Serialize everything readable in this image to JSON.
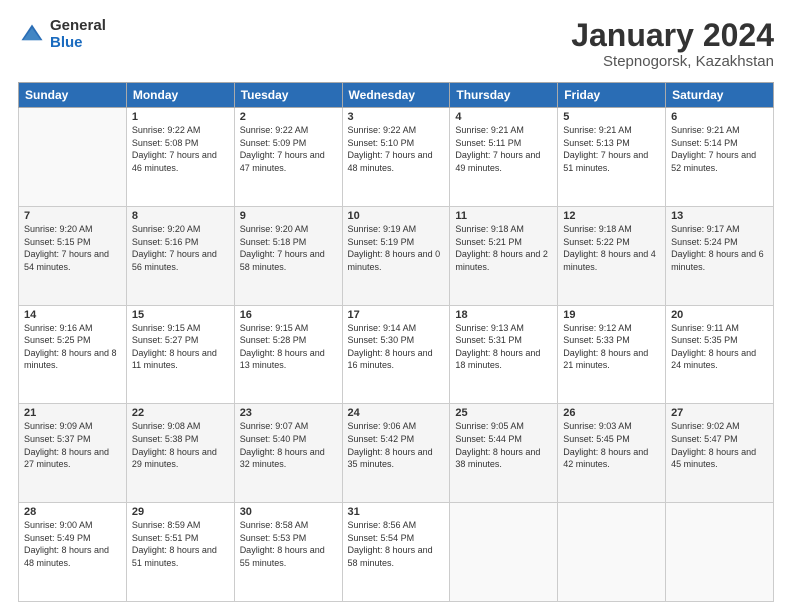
{
  "header": {
    "logo_general": "General",
    "logo_blue": "Blue",
    "title": "January 2024",
    "location": "Stepnogorsk, Kazakhstan"
  },
  "weekdays": [
    "Sunday",
    "Monday",
    "Tuesday",
    "Wednesday",
    "Thursday",
    "Friday",
    "Saturday"
  ],
  "weeks": [
    [
      {
        "day": "",
        "sunrise": "",
        "sunset": "",
        "daylight": ""
      },
      {
        "day": "1",
        "sunrise": "Sunrise: 9:22 AM",
        "sunset": "Sunset: 5:08 PM",
        "daylight": "Daylight: 7 hours and 46 minutes."
      },
      {
        "day": "2",
        "sunrise": "Sunrise: 9:22 AM",
        "sunset": "Sunset: 5:09 PM",
        "daylight": "Daylight: 7 hours and 47 minutes."
      },
      {
        "day": "3",
        "sunrise": "Sunrise: 9:22 AM",
        "sunset": "Sunset: 5:10 PM",
        "daylight": "Daylight: 7 hours and 48 minutes."
      },
      {
        "day": "4",
        "sunrise": "Sunrise: 9:21 AM",
        "sunset": "Sunset: 5:11 PM",
        "daylight": "Daylight: 7 hours and 49 minutes."
      },
      {
        "day": "5",
        "sunrise": "Sunrise: 9:21 AM",
        "sunset": "Sunset: 5:13 PM",
        "daylight": "Daylight: 7 hours and 51 minutes."
      },
      {
        "day": "6",
        "sunrise": "Sunrise: 9:21 AM",
        "sunset": "Sunset: 5:14 PM",
        "daylight": "Daylight: 7 hours and 52 minutes."
      }
    ],
    [
      {
        "day": "7",
        "sunrise": "Sunrise: 9:20 AM",
        "sunset": "Sunset: 5:15 PM",
        "daylight": "Daylight: 7 hours and 54 minutes."
      },
      {
        "day": "8",
        "sunrise": "Sunrise: 9:20 AM",
        "sunset": "Sunset: 5:16 PM",
        "daylight": "Daylight: 7 hours and 56 minutes."
      },
      {
        "day": "9",
        "sunrise": "Sunrise: 9:20 AM",
        "sunset": "Sunset: 5:18 PM",
        "daylight": "Daylight: 7 hours and 58 minutes."
      },
      {
        "day": "10",
        "sunrise": "Sunrise: 9:19 AM",
        "sunset": "Sunset: 5:19 PM",
        "daylight": "Daylight: 8 hours and 0 minutes."
      },
      {
        "day": "11",
        "sunrise": "Sunrise: 9:18 AM",
        "sunset": "Sunset: 5:21 PM",
        "daylight": "Daylight: 8 hours and 2 minutes."
      },
      {
        "day": "12",
        "sunrise": "Sunrise: 9:18 AM",
        "sunset": "Sunset: 5:22 PM",
        "daylight": "Daylight: 8 hours and 4 minutes."
      },
      {
        "day": "13",
        "sunrise": "Sunrise: 9:17 AM",
        "sunset": "Sunset: 5:24 PM",
        "daylight": "Daylight: 8 hours and 6 minutes."
      }
    ],
    [
      {
        "day": "14",
        "sunrise": "Sunrise: 9:16 AM",
        "sunset": "Sunset: 5:25 PM",
        "daylight": "Daylight: 8 hours and 8 minutes."
      },
      {
        "day": "15",
        "sunrise": "Sunrise: 9:15 AM",
        "sunset": "Sunset: 5:27 PM",
        "daylight": "Daylight: 8 hours and 11 minutes."
      },
      {
        "day": "16",
        "sunrise": "Sunrise: 9:15 AM",
        "sunset": "Sunset: 5:28 PM",
        "daylight": "Daylight: 8 hours and 13 minutes."
      },
      {
        "day": "17",
        "sunrise": "Sunrise: 9:14 AM",
        "sunset": "Sunset: 5:30 PM",
        "daylight": "Daylight: 8 hours and 16 minutes."
      },
      {
        "day": "18",
        "sunrise": "Sunrise: 9:13 AM",
        "sunset": "Sunset: 5:31 PM",
        "daylight": "Daylight: 8 hours and 18 minutes."
      },
      {
        "day": "19",
        "sunrise": "Sunrise: 9:12 AM",
        "sunset": "Sunset: 5:33 PM",
        "daylight": "Daylight: 8 hours and 21 minutes."
      },
      {
        "day": "20",
        "sunrise": "Sunrise: 9:11 AM",
        "sunset": "Sunset: 5:35 PM",
        "daylight": "Daylight: 8 hours and 24 minutes."
      }
    ],
    [
      {
        "day": "21",
        "sunrise": "Sunrise: 9:09 AM",
        "sunset": "Sunset: 5:37 PM",
        "daylight": "Daylight: 8 hours and 27 minutes."
      },
      {
        "day": "22",
        "sunrise": "Sunrise: 9:08 AM",
        "sunset": "Sunset: 5:38 PM",
        "daylight": "Daylight: 8 hours and 29 minutes."
      },
      {
        "day": "23",
        "sunrise": "Sunrise: 9:07 AM",
        "sunset": "Sunset: 5:40 PM",
        "daylight": "Daylight: 8 hours and 32 minutes."
      },
      {
        "day": "24",
        "sunrise": "Sunrise: 9:06 AM",
        "sunset": "Sunset: 5:42 PM",
        "daylight": "Daylight: 8 hours and 35 minutes."
      },
      {
        "day": "25",
        "sunrise": "Sunrise: 9:05 AM",
        "sunset": "Sunset: 5:44 PM",
        "daylight": "Daylight: 8 hours and 38 minutes."
      },
      {
        "day": "26",
        "sunrise": "Sunrise: 9:03 AM",
        "sunset": "Sunset: 5:45 PM",
        "daylight": "Daylight: 8 hours and 42 minutes."
      },
      {
        "day": "27",
        "sunrise": "Sunrise: 9:02 AM",
        "sunset": "Sunset: 5:47 PM",
        "daylight": "Daylight: 8 hours and 45 minutes."
      }
    ],
    [
      {
        "day": "28",
        "sunrise": "Sunrise: 9:00 AM",
        "sunset": "Sunset: 5:49 PM",
        "daylight": "Daylight: 8 hours and 48 minutes."
      },
      {
        "day": "29",
        "sunrise": "Sunrise: 8:59 AM",
        "sunset": "Sunset: 5:51 PM",
        "daylight": "Daylight: 8 hours and 51 minutes."
      },
      {
        "day": "30",
        "sunrise": "Sunrise: 8:58 AM",
        "sunset": "Sunset: 5:53 PM",
        "daylight": "Daylight: 8 hours and 55 minutes."
      },
      {
        "day": "31",
        "sunrise": "Sunrise: 8:56 AM",
        "sunset": "Sunset: 5:54 PM",
        "daylight": "Daylight: 8 hours and 58 minutes."
      },
      {
        "day": "",
        "sunrise": "",
        "sunset": "",
        "daylight": ""
      },
      {
        "day": "",
        "sunrise": "",
        "sunset": "",
        "daylight": ""
      },
      {
        "day": "",
        "sunrise": "",
        "sunset": "",
        "daylight": ""
      }
    ]
  ]
}
